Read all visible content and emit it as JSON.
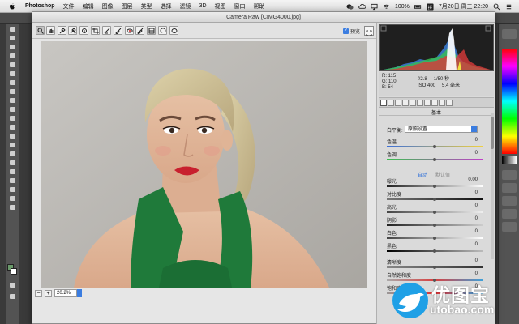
{
  "menubar": {
    "app": "Photoshop",
    "items": [
      "文件",
      "编辑",
      "图像",
      "图层",
      "类型",
      "选择",
      "滤镜",
      "3D",
      "视图",
      "窗口",
      "帮助"
    ],
    "battery": "100%",
    "datetime": "7月20日 周三  22:20"
  },
  "dialog": {
    "title": "Camera Raw [CIMG4000.jpg]",
    "preview_label": "预览",
    "zoom": "20.2%"
  },
  "readout": {
    "r": "R:  115",
    "g": "G:  110",
    "b": "B:   54",
    "aperture": "f/2.8",
    "shutter": "1/50 秒",
    "iso": "ISO 400",
    "focal": "5.4 毫米"
  },
  "panel": {
    "section": "基本",
    "wb_label": "白平衡:",
    "wb_value": "原照设置",
    "auto": "自动",
    "default": "默认值",
    "rows": [
      {
        "label": "色温",
        "value": "0"
      },
      {
        "label": "色调",
        "value": "0"
      },
      {
        "label": "曝光",
        "value": "0.00"
      },
      {
        "label": "对比度",
        "value": "0"
      },
      {
        "label": "高光",
        "value": "0"
      },
      {
        "label": "阴影",
        "value": "0"
      },
      {
        "label": "白色",
        "value": "0"
      },
      {
        "label": "黑色",
        "value": "0"
      },
      {
        "label": "清晰度",
        "value": "0"
      },
      {
        "label": "自然饱和度",
        "value": "0"
      },
      {
        "label": "饱和度",
        "value": "0"
      }
    ]
  },
  "watermark": {
    "cn": "优图宝",
    "en": "utobao.com"
  }
}
